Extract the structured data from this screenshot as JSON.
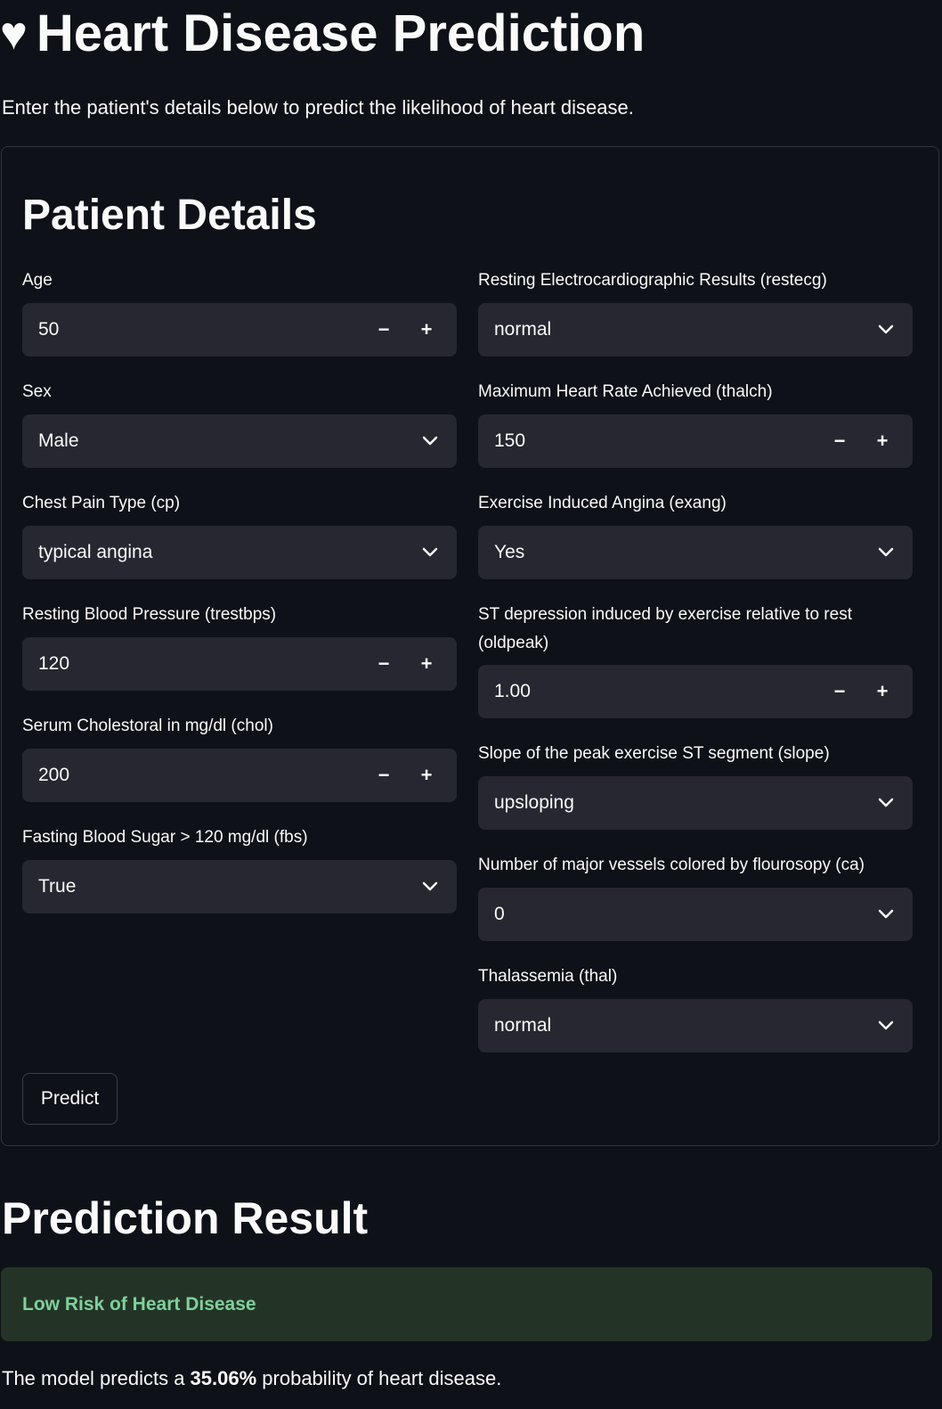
{
  "header": {
    "heart_icon": "♥",
    "title": "Heart Disease Prediction",
    "subtitle": "Enter the patient's details below to predict the likelihood of heart disease."
  },
  "form": {
    "heading": "Patient Details",
    "left": {
      "age": {
        "label": "Age",
        "value": "50"
      },
      "sex": {
        "label": "Sex",
        "value": "Male"
      },
      "cp": {
        "label": "Chest Pain Type (cp)",
        "value": "typical angina"
      },
      "trestbps": {
        "label": "Resting Blood Pressure (trestbps)",
        "value": "120"
      },
      "chol": {
        "label": "Serum Cholestoral in mg/dl (chol)",
        "value": "200"
      },
      "fbs": {
        "label": "Fasting Blood Sugar > 120 mg/dl (fbs)",
        "value": "True"
      }
    },
    "right": {
      "restecg": {
        "label": "Resting Electrocardiographic Results (restecg)",
        "value": "normal"
      },
      "thalch": {
        "label": "Maximum Heart Rate Achieved (thalch)",
        "value": "150"
      },
      "exang": {
        "label": "Exercise Induced Angina (exang)",
        "value": "Yes"
      },
      "oldpeak": {
        "label": "ST depression induced by exercise relative to rest (oldpeak)",
        "value": "1.00"
      },
      "slope": {
        "label": "Slope of the peak exercise ST segment (slope)",
        "value": "upsloping"
      },
      "ca": {
        "label": "Number of major vessels colored by flourosopy (ca)",
        "value": "0"
      },
      "thal": {
        "label": "Thalassemia (thal)",
        "value": "normal"
      }
    },
    "stepper": {
      "minus": "−",
      "plus": "+"
    },
    "predict_label": "Predict"
  },
  "result": {
    "heading": "Prediction Result",
    "status": "Low Risk of Heart Disease",
    "text_prefix": "The model predicts a ",
    "probability": "35.06%",
    "text_suffix": " probability of heart disease."
  },
  "colors": {
    "background": "#0e1117",
    "field": "#262730",
    "success_bg": "#233427",
    "success_text": "#7fd19a"
  }
}
